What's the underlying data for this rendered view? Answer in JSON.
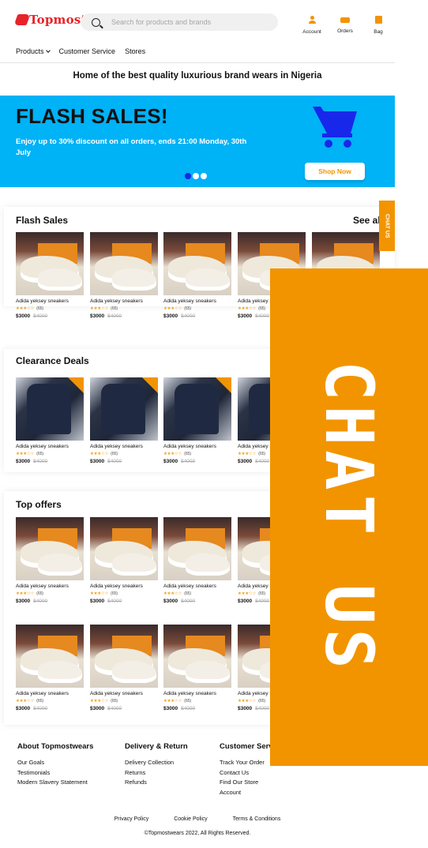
{
  "header": {
    "logo_text": "Topmost",
    "search_placeholder": "Search for products and brands",
    "icons": [
      {
        "name": "account",
        "label": "Account"
      },
      {
        "name": "orders",
        "label": "Orders"
      },
      {
        "name": "bag",
        "label": "Bag"
      }
    ]
  },
  "nav": {
    "products": "Products",
    "customer_service": "Customer Service",
    "stores": "Stores"
  },
  "tagline": "Home of the best quality luxurious brand wears in Nigeria",
  "hero": {
    "title": "FLASH SALES!",
    "subtitle": "Enjoy up to 30% discount on all orders, ends 21:00 Monday, 30th July",
    "button": "Shop Now",
    "active_slide": 1,
    "slides": 3,
    "colors": {
      "background": "#00b2f6",
      "cart": "#1728ea",
      "accent": "#f29400"
    }
  },
  "sections": {
    "flash": {
      "title": "Flash Sales",
      "see_all": "See all"
    },
    "clearance": {
      "title": "Clearance Deals"
    },
    "top_offers": {
      "title": "Top offers"
    }
  },
  "product": {
    "name": "Adida yeksey sneakers",
    "name_cut": "Adida yeksey s",
    "stars": "★★★☆☆",
    "reviews": "(65)",
    "price": "$3000",
    "old_price": "$4000"
  },
  "footer": {
    "about": {
      "title": "About Topmostwears",
      "links": [
        "Our Goals",
        "Testimonials",
        "Modern Slavery Statement"
      ]
    },
    "delivery": {
      "title": "Delivery & Return",
      "links": [
        "Delivery Collection",
        "Returns",
        "Refunds"
      ]
    },
    "customer": {
      "title": "Customer Serv",
      "links": [
        "Track Your Order",
        "Contact Us",
        "Find Our Store",
        "Account"
      ]
    },
    "bottom_links": [
      "Privacy Policy",
      "Cookie Policy",
      "Terms & Conditions"
    ],
    "copyright": "©Topmostwears 2022, All Rights Reserved."
  },
  "chat": {
    "tab_label": "CHAT US",
    "panel_label": "CHAT US"
  }
}
